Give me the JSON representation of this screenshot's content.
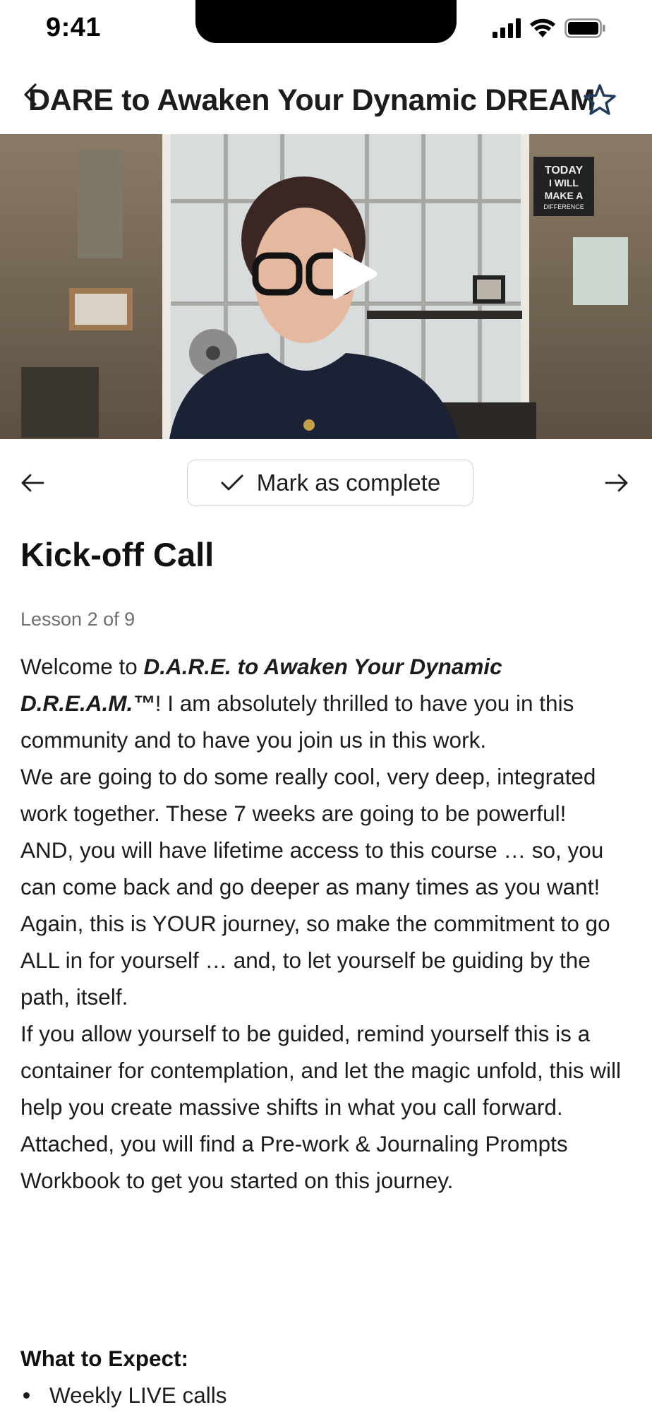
{
  "status_bar": {
    "time": "9:41"
  },
  "header": {
    "title": "DARE to Awaken Your Dynamic DREAM",
    "back_icon": "chevron-left-icon",
    "favorite_icon": "star-icon"
  },
  "video": {
    "play_icon": "play-icon",
    "poster_text": "TODAY I WILL MAKE A DIFFERENCE"
  },
  "navigation": {
    "prev_icon": "arrow-left-icon",
    "next_icon": "arrow-right-icon",
    "mark_complete_label": "Mark as complete"
  },
  "lesson": {
    "title": "Kick-off Call",
    "counter": "Lesson 2 of 9",
    "p1_pre": "Welcome to ",
    "p1_em": "D.A.R.E. to Awaken Your Dynamic D.R.E.A.M.™",
    "p1_post": "! I am absolutely thrilled to have you in this community and to have you join us in this work.",
    "p2": "We are going to do some really cool, very deep, integrated work together. These 7 weeks are going to be powerful!",
    "p3": "AND, you will have lifetime access to this course … so, you can come back and go deeper as many times as you want!",
    "p4": "Again, this is YOUR journey, so make the commitment to go ALL in for yourself … and, to let yourself be guiding by the path, itself.",
    "p5": "If you allow yourself to be guided, remind yourself this is a container for contemplation, and let the magic unfold, this will help you create massive shifts in what you call forward.",
    "p6": "Attached, you will find a Pre-work & Journaling Prompts Workbook to get you started on this journey.",
    "section_title": "What to Expect:",
    "bullets": [
      "Weekly LIVE calls"
    ]
  },
  "colors": {
    "text": "#1c1c1e",
    "muted": "#6e6e73",
    "border": "#cfcfd3",
    "star": "#1f3a5a"
  }
}
